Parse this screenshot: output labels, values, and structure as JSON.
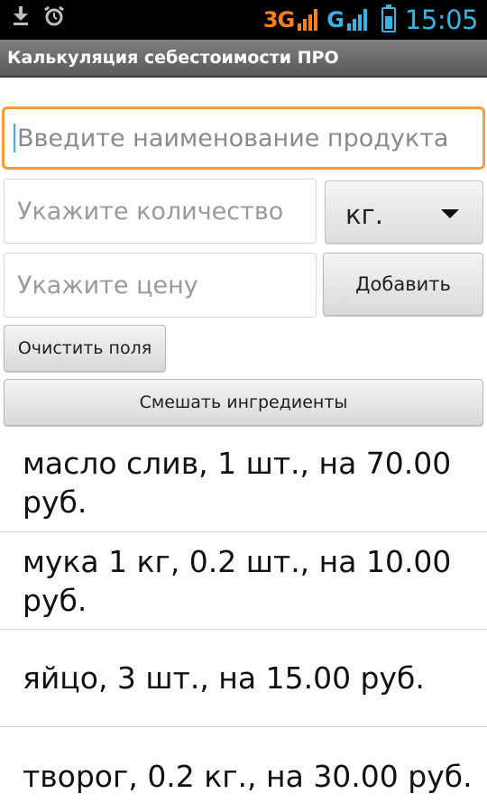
{
  "status_bar": {
    "left_icons": [
      "download-icon",
      "alarm-icon"
    ],
    "network_1": "3G",
    "network_2": "G",
    "time": "15:05",
    "colors": {
      "orange": "#ff7f1a",
      "blue": "#33b5e5"
    },
    "battery_level": 0.75
  },
  "app": {
    "title": "Калькуляция себестоимости ПРО"
  },
  "form": {
    "product_placeholder": "Введите наименование продукта",
    "quantity_placeholder": "Укажите количество",
    "unit_selected": "кг.",
    "price_placeholder": "Укажите цену",
    "add_label": "Добавить",
    "clear_label": "Очистить поля",
    "mix_label": "Смешать ингредиенты"
  },
  "ingredients": [
    "масло слив, 1 шт., на 70.00 руб.",
    "мука 1 кг, 0.2 шт., на 10.00 руб.",
    "яйцо, 3 шт., на 15.00 руб.",
    "творог, 0.2 кг., на 30.00 руб."
  ]
}
